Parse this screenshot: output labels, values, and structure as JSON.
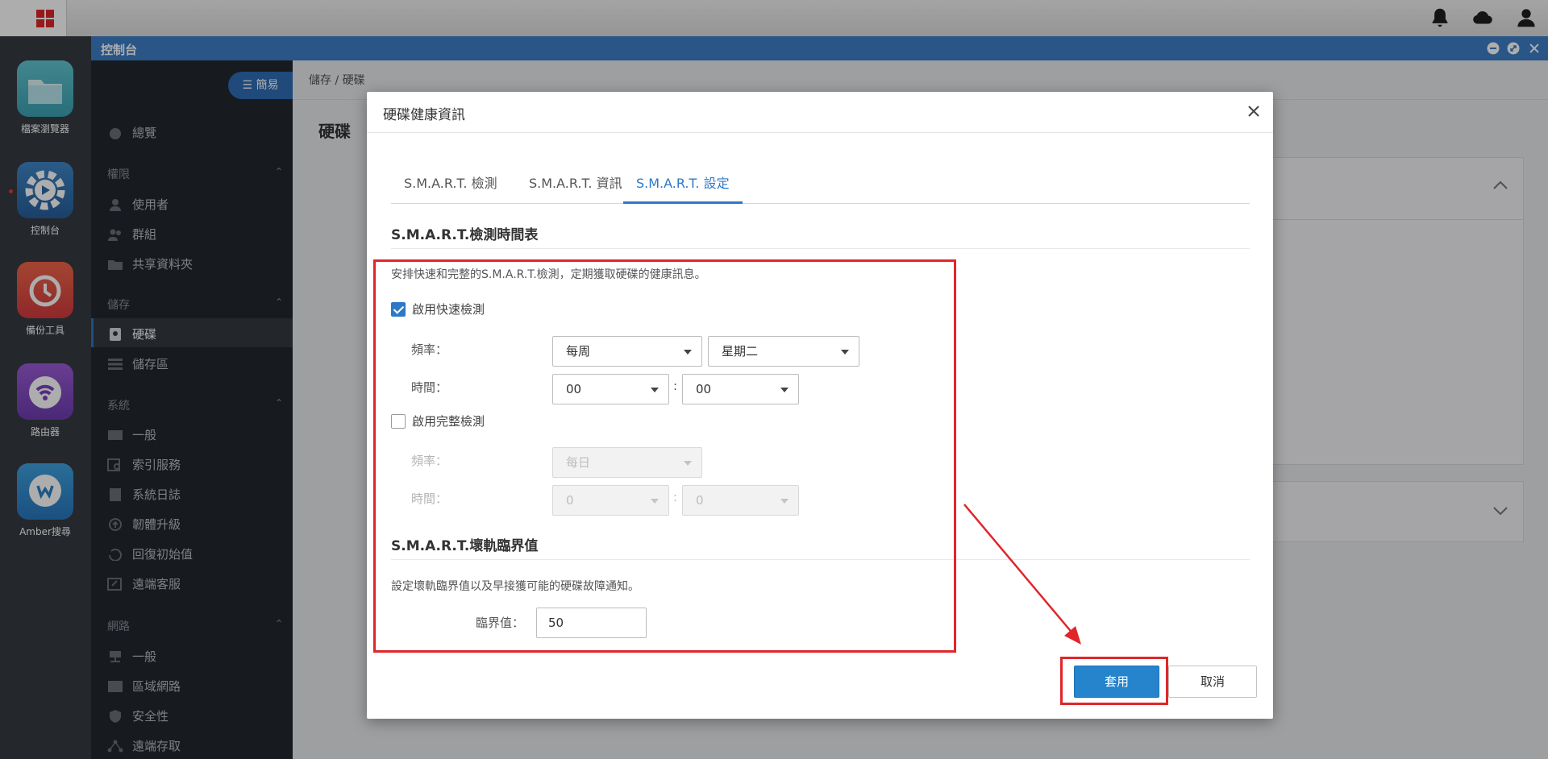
{
  "window": {
    "title": "控制台"
  },
  "sidebar": {
    "simple_button": "簡易",
    "overview": "總覽",
    "groups": [
      {
        "title": "權限",
        "items": [
          "使用者",
          "群組",
          "共享資料夾"
        ]
      },
      {
        "title": "儲存",
        "items": [
          "硬碟",
          "儲存區"
        ]
      },
      {
        "title": "系統",
        "items": [
          "一般",
          "索引服務",
          "系統日誌",
          "韌體升級",
          "回復初始值",
          "遠端客服"
        ]
      },
      {
        "title": "網路",
        "items": [
          "一般",
          "區域網路",
          "安全性",
          "遠端存取"
        ]
      }
    ],
    "active_item": "硬碟"
  },
  "dock": {
    "apps": [
      {
        "label": "檔案瀏覽器",
        "icon": "folder-icon"
      },
      {
        "label": "控制台",
        "icon": "gear-icon"
      },
      {
        "label": "備份工具",
        "icon": "backup-clock-icon"
      },
      {
        "label": "路由器",
        "icon": "wifi-icon"
      },
      {
        "label": "Amber搜尋",
        "icon": "search-chat-icon"
      }
    ]
  },
  "main": {
    "breadcrumb": "儲存 / 硬碟",
    "page_title": "硬碟"
  },
  "dialog": {
    "title": "硬碟健康資訊",
    "tabs": [
      "S.M.A.R.T. 檢測",
      "S.M.A.R.T. 資訊",
      "S.M.A.R.T. 設定"
    ],
    "active_tab": "S.M.A.R.T. 設定",
    "schedule": {
      "title": "S.M.A.R.T.檢測時間表",
      "description": "安排快速和完整的S.M.A.R.T.檢測，定期獲取硬碟的健康訊息。",
      "quick": {
        "label": "啟用快速檢測",
        "checked": true,
        "freq_label": "頻率：",
        "frequency": "每周",
        "weekday": "星期二",
        "time_label": "時間：",
        "hour": "00",
        "minute": "00",
        "separator": ":"
      },
      "full": {
        "label": "啟用完整檢測",
        "checked": false,
        "freq_label": "頻率：",
        "frequency": "每日",
        "time_label": "時間：",
        "hour": "0",
        "minute": "0",
        "separator": ":"
      }
    },
    "threshold": {
      "title": "S.M.A.R.T.壞軌臨界值",
      "description": "設定壞軌臨界值以及早接獲可能的硬碟故障通知。",
      "label": "臨界值：",
      "value": "50"
    },
    "buttons": {
      "apply": "套用",
      "cancel": "取消"
    }
  },
  "colors": {
    "accent": "#2d79c7",
    "annotation": "#e0262a",
    "titlebar": "#3d7ec8"
  }
}
